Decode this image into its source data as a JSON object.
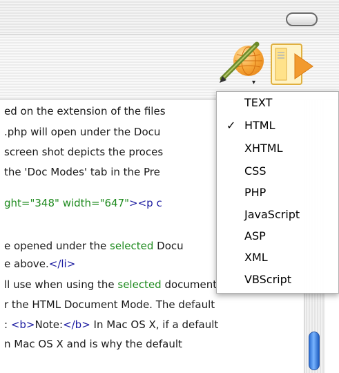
{
  "content": {
    "lines": [
      {
        "parts": [
          {
            "t": "ed on the extension of the files",
            "c": ""
          }
        ]
      },
      {
        "parts": [
          {
            "t": ".php will open under the Docu",
            "c": ""
          }
        ]
      },
      {
        "parts": [
          {
            "t": "screen shot depicts the proces",
            "c": ""
          }
        ]
      },
      {
        "parts": [
          {
            "t": " the 'Doc Modes' tab in the Pre",
            "c": ""
          }
        ]
      },
      {
        "parts": [
          {
            "t": "ght=",
            "c": "c-green"
          },
          {
            "t": "\"348\"",
            "c": "c-green"
          },
          {
            "t": " width=",
            "c": "c-green"
          },
          {
            "t": "\"647\"",
            "c": "c-green"
          },
          {
            "t": "><p c",
            "c": "c-blue"
          }
        ]
      },
      {
        "parts": [
          {
            "t": "e opened under the ",
            "c": ""
          },
          {
            "t": "selected",
            "c": "c-green"
          },
          {
            "t": " Docu",
            "c": ""
          }
        ]
      },
      {
        "parts": [
          {
            "t": "e above.",
            "c": ""
          },
          {
            "t": "</li>",
            "c": "c-blue"
          }
        ]
      },
      {
        "parts": [
          {
            "t": "ll use when using the ",
            "c": ""
          },
          {
            "t": "selected",
            "c": "c-green"
          },
          {
            "t": " document",
            "c": ""
          }
        ]
      },
      {
        "parts": [
          {
            "t": "r the HTML Document Mode. The default",
            "c": ""
          }
        ]
      },
      {
        "parts": [
          {
            "t": ": ",
            "c": ""
          },
          {
            "t": "<b>",
            "c": "c-blue"
          },
          {
            "t": "Note:",
            "c": ""
          },
          {
            "t": "</b>",
            "c": "c-blue"
          },
          {
            "t": " In Mac OS X, if a default",
            "c": ""
          }
        ]
      },
      {
        "parts": [
          {
            "t": "n Mac OS X and is why the default",
            "c": ""
          }
        ]
      }
    ]
  },
  "menu": {
    "items": [
      {
        "label": "TEXT",
        "checked": false
      },
      {
        "label": "HTML",
        "checked": true
      },
      {
        "label": "XHTML",
        "checked": false
      },
      {
        "label": "CSS",
        "checked": false
      },
      {
        "label": "PHP",
        "checked": false
      },
      {
        "label": "JavaScript",
        "checked": false
      },
      {
        "label": "ASP",
        "checked": false
      },
      {
        "label": "XML",
        "checked": false
      },
      {
        "label": "VBScript",
        "checked": false
      }
    ],
    "checkmark": "✓"
  },
  "toolbar": {
    "popup_arrow": "▾",
    "icons": [
      "globe-icon",
      "pen-icon",
      "preview-play-icon"
    ]
  },
  "colors": {
    "accent_orange": "#f7a83a",
    "tag_blue": "#1a1aa0",
    "attr_green": "#1d8a1d",
    "scroll_blue": "#2d6fd2"
  }
}
